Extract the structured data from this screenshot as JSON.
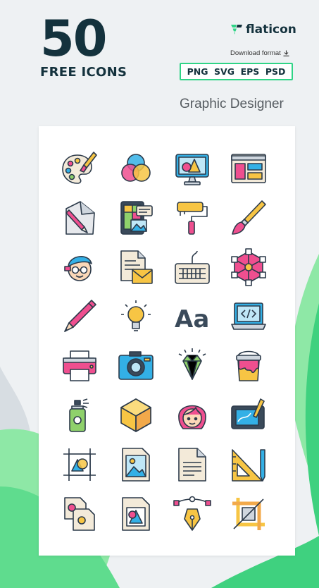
{
  "header": {
    "count": "50",
    "subtitle": "FREE ICONS",
    "brand_name": "flaticon",
    "download_label": "Download format",
    "formats": [
      "PNG",
      "SVG",
      "EPS",
      "PSD"
    ],
    "category": "Graphic Designer"
  },
  "colors": {
    "navy": "#14323d",
    "green_accent": "#2fd486",
    "bg_green_light": "#8ee8a6",
    "bg_green_dark": "#3fd17f",
    "outline": "#2c3a4a"
  },
  "icons": [
    "palette-icon",
    "color-mixing-icon",
    "monitor-shapes-icon",
    "web-layout-icon",
    "drawing-paper-icon",
    "tablet-gallery-icon",
    "paint-roller-icon",
    "paint-brush-icon",
    "designer-avatar-icon",
    "email-document-icon",
    "keyboard-icon",
    "vector-nodes-icon",
    "pencil-icon",
    "idea-bulb-icon",
    "typography-icon",
    "code-laptop-icon",
    "printer-icon",
    "camera-icon",
    "diamond-icon",
    "paint-bucket-icon",
    "spray-can-icon",
    "cube-icon",
    "girl-avatar-icon",
    "graphic-tablet-icon",
    "crop-canvas-icon",
    "image-file-icon",
    "text-file-icon",
    "set-square-icon",
    "file-copy-icon",
    "shape-file-icon",
    "pen-tool-icon",
    "crop-tool-icon"
  ]
}
